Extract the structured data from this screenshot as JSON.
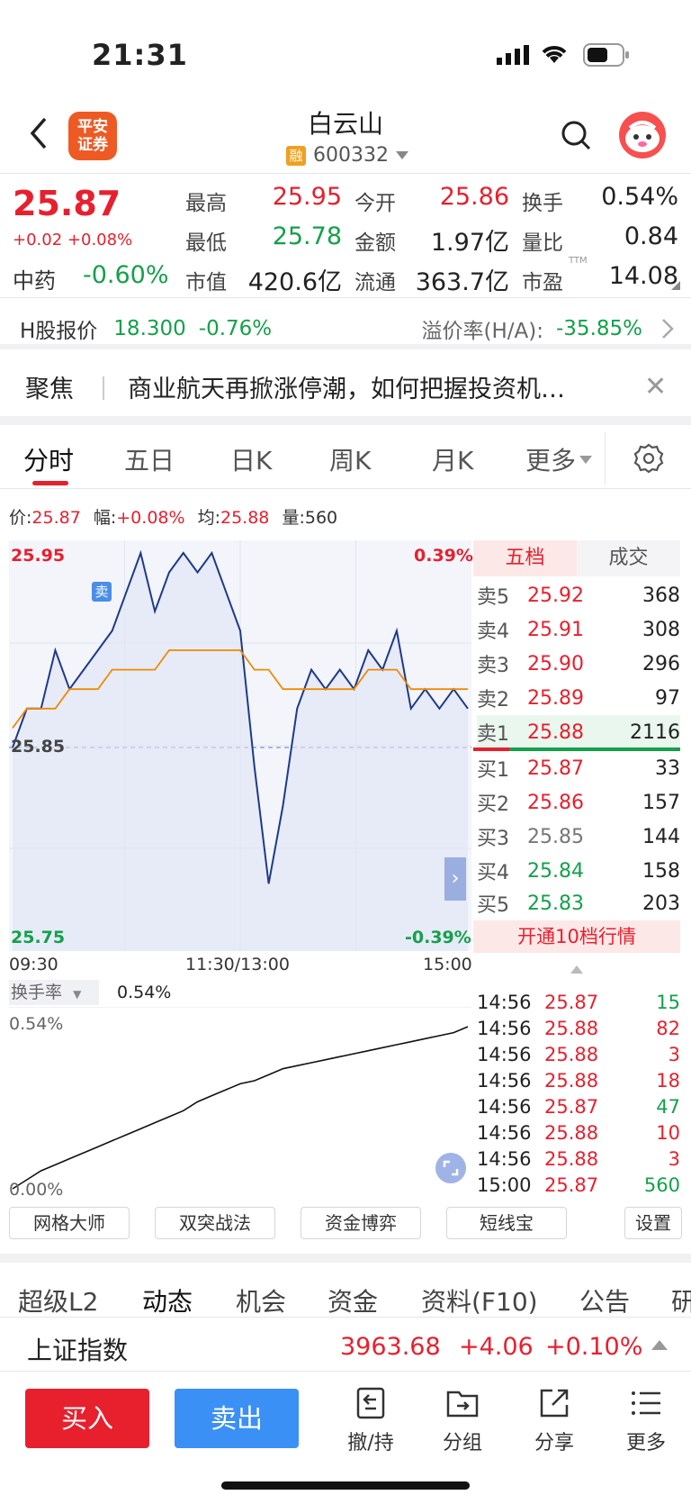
{
  "status_bar": {
    "time": "21:31"
  },
  "header": {
    "logo_text": "平安证券",
    "stock_name": "白云山",
    "margin_badge": "融",
    "stock_code": "600332"
  },
  "quote": {
    "price": "25.87",
    "change": "+0.02",
    "change_pct": "+0.08%",
    "sector_name": "中药",
    "sector_change": "-0.60%",
    "stats": [
      {
        "label": "最高",
        "value": "25.95"
      },
      {
        "label": "今开",
        "value": "25.86"
      },
      {
        "label": "换手",
        "value": "0.54%"
      },
      {
        "label": "最低",
        "value": "25.78"
      },
      {
        "label": "金额",
        "value": "1.97亿"
      },
      {
        "label": "量比",
        "value": "0.84"
      },
      {
        "label": "市值",
        "value": "420.6亿"
      },
      {
        "label": "流通",
        "value": "363.7亿"
      },
      {
        "label": "市盈",
        "value": "14.08",
        "suffix": "TTM"
      }
    ]
  },
  "h_share": {
    "label": "H股报价",
    "price": "18.300",
    "change": "-0.76%",
    "premium_label": "溢价率(H/A):",
    "premium_value": "-35.85%"
  },
  "focus": {
    "label": "聚焦",
    "headline": "商业航天再掀涨停潮，如何把握投资机…"
  },
  "chart_tabs": [
    "分时",
    "五日",
    "日K",
    "周K",
    "月K",
    "更多"
  ],
  "info_line": {
    "price_label": "价:",
    "price": "25.87",
    "range_label": "幅:",
    "range": "+0.08%",
    "avg_label": "均:",
    "avg": "25.88",
    "vol_label": "量:",
    "vol": "560"
  },
  "chart": {
    "y_top": "25.95",
    "y_mid": "25.85",
    "y_bottom": "25.75",
    "pct_top": "0.39%",
    "pct_bottom": "-0.39%",
    "sell_marker": "卖",
    "x_labels": [
      "09:30",
      "11:30/13:00",
      "15:00"
    ]
  },
  "chart_data": {
    "type": "line",
    "x": [
      "09:30",
      "09:37",
      "09:45",
      "09:52",
      "10:00",
      "10:07",
      "10:15",
      "10:22",
      "10:30",
      "10:37",
      "10:45",
      "10:52",
      "11:00",
      "11:07",
      "11:15",
      "11:22",
      "11:30",
      "13:07",
      "13:15",
      "13:22",
      "13:30",
      "13:37",
      "13:45",
      "13:52",
      "14:00",
      "14:07",
      "14:15",
      "14:22",
      "14:30",
      "14:37",
      "14:45",
      "14:52",
      "15:00"
    ],
    "series": [
      {
        "values": [
          25.85,
          25.87,
          25.87,
          25.9,
          25.88,
          25.89,
          25.9,
          25.91,
          25.93,
          25.95,
          25.92,
          25.94,
          25.95,
          25.94,
          25.95,
          25.93,
          25.91,
          25.84,
          25.78,
          25.82,
          25.87,
          25.89,
          25.88,
          25.89,
          25.88,
          25.9,
          25.89,
          25.91,
          25.87,
          25.88,
          25.87,
          25.88,
          25.87
        ]
      },
      {
        "values": [
          25.86,
          25.87,
          25.87,
          25.87,
          25.88,
          25.88,
          25.88,
          25.89,
          25.89,
          25.89,
          25.89,
          25.9,
          25.9,
          25.9,
          25.9,
          25.9,
          25.9,
          25.89,
          25.89,
          25.88,
          25.88,
          25.88,
          25.88,
          25.88,
          25.88,
          25.89,
          25.89,
          25.89,
          25.88,
          25.88,
          25.88,
          25.88,
          25.88
        ]
      }
    ],
    "ylim": [
      25.75,
      25.95
    ],
    "reference": 25.85,
    "turnover": {
      "label": "换手率",
      "value": "0.54%",
      "y_top": "0.54%",
      "y_bottom": "0.00%",
      "values": [
        0,
        0.03,
        0.06,
        0.08,
        0.1,
        0.12,
        0.14,
        0.16,
        0.18,
        0.2,
        0.22,
        0.24,
        0.26,
        0.29,
        0.31,
        0.33,
        0.35,
        0.36,
        0.38,
        0.4,
        0.41,
        0.42,
        0.43,
        0.44,
        0.45,
        0.46,
        0.47,
        0.48,
        0.49,
        0.5,
        0.51,
        0.52,
        0.54
      ]
    }
  },
  "orderbook": {
    "tabs": [
      "五档",
      "成交"
    ],
    "asks": [
      {
        "label": "卖5",
        "price": "25.92",
        "vol": "368"
      },
      {
        "label": "卖4",
        "price": "25.91",
        "vol": "308"
      },
      {
        "label": "卖3",
        "price": "25.90",
        "vol": "296"
      },
      {
        "label": "卖2",
        "price": "25.89",
        "vol": "97"
      },
      {
        "label": "卖1",
        "price": "25.88",
        "vol": "2116"
      }
    ],
    "bids": [
      {
        "label": "买1",
        "price": "25.87",
        "vol": "33"
      },
      {
        "label": "买2",
        "price": "25.86",
        "vol": "157"
      },
      {
        "label": "买3",
        "price": "25.85",
        "vol": "144"
      },
      {
        "label": "买4",
        "price": "25.84",
        "vol": "158"
      },
      {
        "label": "买5",
        "price": "25.83",
        "vol": "203"
      }
    ],
    "unlock_text": "开通10档行情"
  },
  "ticks": [
    {
      "time": "14:56",
      "price": "25.87",
      "vol": "15"
    },
    {
      "time": "14:56",
      "price": "25.88",
      "vol": "82"
    },
    {
      "time": "14:56",
      "price": "25.88",
      "vol": "3"
    },
    {
      "time": "14:56",
      "price": "25.88",
      "vol": "18"
    },
    {
      "time": "14:56",
      "price": "25.87",
      "vol": "47"
    },
    {
      "time": "14:56",
      "price": "25.88",
      "vol": "10"
    },
    {
      "time": "14:56",
      "price": "25.88",
      "vol": "3"
    },
    {
      "time": "15:00",
      "price": "25.87",
      "vol": "560"
    }
  ],
  "tools": [
    "网格大师",
    "双突战法",
    "资金博弈",
    "短线宝",
    "设置"
  ],
  "lower_tabs": [
    "超级L2",
    "动态",
    "机会",
    "资金",
    "资料(F10)",
    "公告",
    "研"
  ],
  "index": {
    "name": "上证指数",
    "value": "3963.68",
    "change": "+4.06",
    "pct": "+0.10%"
  },
  "bottom_bar": {
    "buy": "买入",
    "sell": "卖出",
    "items": [
      "撤/持",
      "分组",
      "分享",
      "更多"
    ]
  }
}
